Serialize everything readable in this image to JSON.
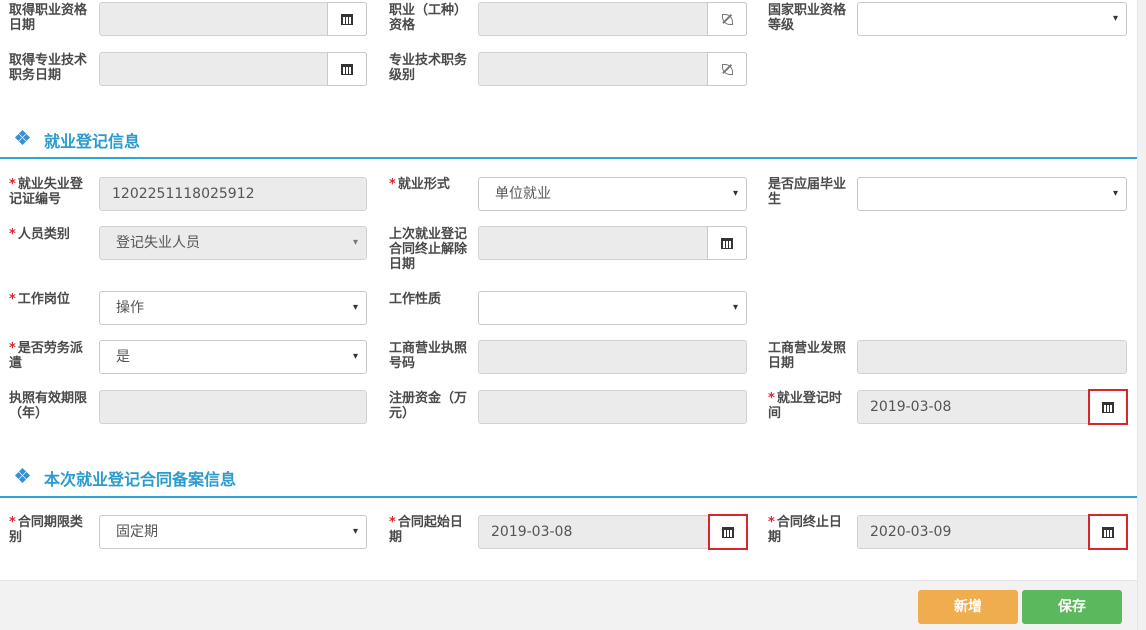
{
  "colors": {
    "accent": "#2aa7d6",
    "required": "#d9262b",
    "btn_add": "#f0ad4e",
    "btn_save": "#5cb85c",
    "highlight": "#d9262b"
  },
  "top": {
    "qual_date_label": "取得职业资格日期",
    "occupation_label": "职业（工种）资格",
    "national_level_label": "国家职业资格等级",
    "title_date_label": "取得专业技术职务日期",
    "title_level_label": "专业技术职务级别"
  },
  "employment": {
    "section_title": "就业登记信息",
    "cert_no_label": "就业失业登记证编号",
    "cert_no_value": "1202251118025912",
    "form_label": "就业形式",
    "form_value": "单位就业",
    "fresh_grad_label": "是否应届毕业生",
    "fresh_grad_value": "",
    "person_type_label": "人员类别",
    "person_type_value": "登记失业人员",
    "last_contract_end_label": "上次就业登记合同终止解除日期",
    "job_post_label": "工作岗位",
    "job_post_value": "操作",
    "job_nature_label": "工作性质",
    "job_nature_value": "",
    "labor_dispatch_label": "是否劳务派遣",
    "labor_dispatch_value": "是",
    "biz_license_no_label": "工商营业执照号码",
    "biz_license_date_label": "工商营业发照日期",
    "license_validity_label": "执照有效期限（年）",
    "reg_capital_label": "注册资金（万元）",
    "reg_time_label": "就业登记时间",
    "reg_time_value": "2019-03-08"
  },
  "contract": {
    "section_title": "本次就业登记合同备案信息",
    "term_type_label": "合同期限类别",
    "term_type_value": "固定期",
    "start_label": "合同起始日期",
    "start_value": "2019-03-08",
    "end_label": "合同终止日期",
    "end_value": "2020-03-09"
  },
  "footer": {
    "add_label": "新增",
    "save_label": "保存"
  },
  "required_mark": "*",
  "icons": {
    "calendar": "calendar-icon",
    "leaf": "leaf-icon",
    "caret": "▾"
  }
}
